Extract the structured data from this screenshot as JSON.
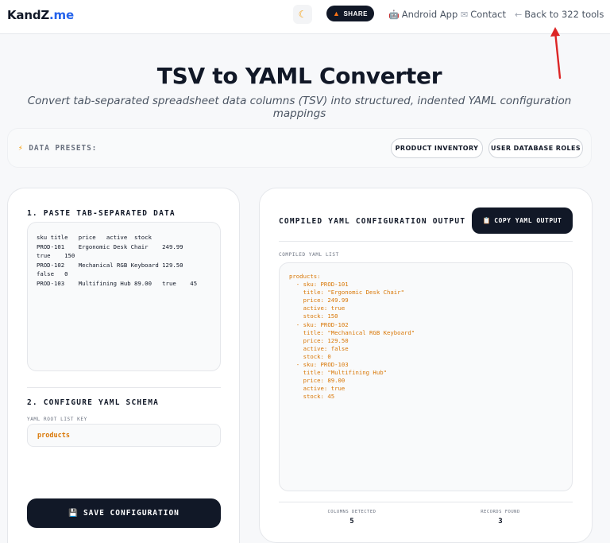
{
  "header": {
    "brand_main": "KandZ",
    "brand_suffix": ".me",
    "theme_icon": "moon-icon",
    "share_label": "SHARE",
    "nav": [
      {
        "icon": "robot-icon",
        "glyph": "🤖",
        "label": "Android App"
      },
      {
        "icon": "envelope-icon",
        "glyph": "✉",
        "label": "Contact"
      },
      {
        "icon": "arrow-left-icon",
        "glyph": "←",
        "label": "Back to 322 tools"
      }
    ]
  },
  "page": {
    "title": "TSV to YAML Converter",
    "subtitle": "Convert tab-separated spreadsheet data columns (TSV) into structured, indented YAML configuration mappings"
  },
  "presets": {
    "label": "DATA PRESETS:",
    "icon": "lightning-icon",
    "buttons": [
      "PRODUCT INVENTORY",
      "USER DATABASE ROLES"
    ]
  },
  "input_panel": {
    "section1_title": "1. PASTE TAB-SEPARATED DATA",
    "tsv_text": "sku title   price   active  stock\nPROD-101    Ergonomic Desk Chair    249.99\ntrue    150\nPROD-102    Mechanical RGB Keyboard 129.50\nfalse   0\nPROD-103    Multifining Hub 89.00   true    45",
    "section2_title": "2. CONFIGURE YAML SCHEMA",
    "root_key_label": "YAML ROOT LIST KEY",
    "root_key_value": "products",
    "save_label": "SAVE CONFIGURATION",
    "save_icon": "floppy-disk-icon"
  },
  "output_panel": {
    "title": "COMPILED YAML CONFIGURATION OUTPUT",
    "copy_label": "COPY YAML OUTPUT",
    "copy_icon": "clipboard-icon",
    "list_label": "COMPILED YAML LIST",
    "yaml_text": "products:\n  - sku: PROD-101\n    title: \"Ergonomic Desk Chair\"\n    price: 249.99\n    active: true\n    stock: 150\n  - sku: PROD-102\n    title: \"Mechanical RGB Keyboard\"\n    price: 129.50\n    active: false\n    stock: 0\n  - sku: PROD-103\n    title: \"Multifining Hub\"\n    price: 89.00\n    active: true\n    stock: 45",
    "stats": [
      {
        "label": "COLUMNS DETECTED",
        "value": "5"
      },
      {
        "label": "RECORDS FOUND",
        "value": "3"
      }
    ]
  },
  "colors": {
    "accent": "#2563eb",
    "dark": "#111827",
    "yaml_text": "#d97706",
    "annotation_arrow": "#dc2626"
  }
}
